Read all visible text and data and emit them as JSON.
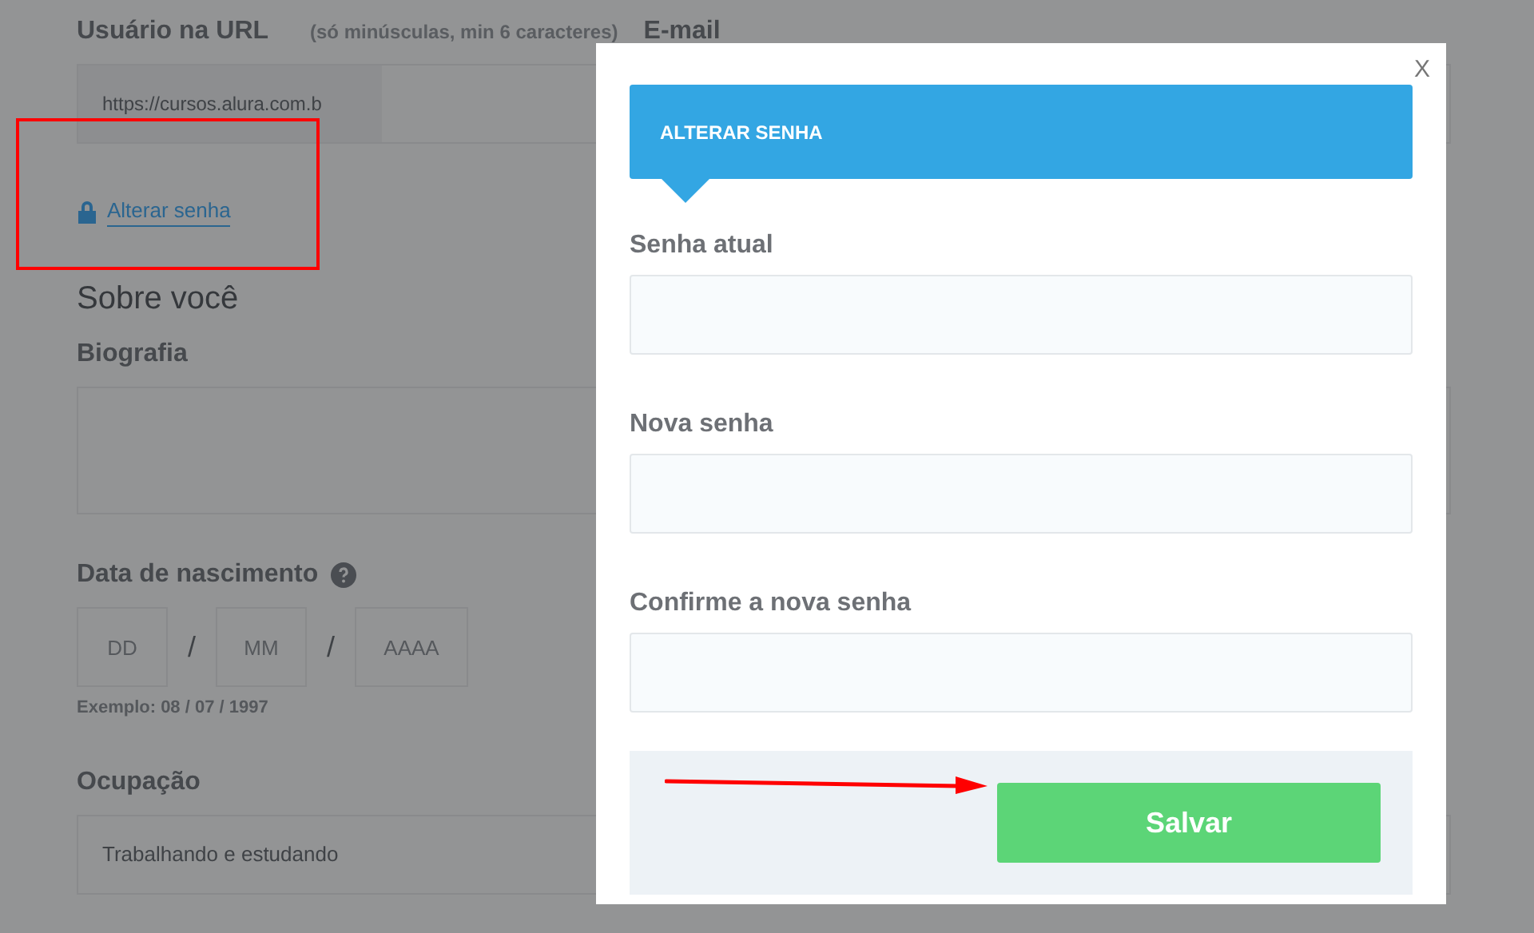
{
  "page": {
    "url_label": "Usuário na URL",
    "url_hint": "(só minúsculas, min 6 caracteres)",
    "email_label": "E-mail",
    "url_value": "https://cursos.alura.com.b",
    "change_password_link": "Alterar senha",
    "about_heading": "Sobre você",
    "bio_label": "Biografia",
    "birth_label": "Data de nascimento",
    "birth_fields": [
      {
        "placeholder": "DD"
      },
      {
        "placeholder": "MM"
      },
      {
        "placeholder": "AAAA"
      }
    ],
    "date_separator": "/",
    "birth_example": "Exemplo: 08 / 07 / 1997",
    "occupation_label": "Ocupação",
    "occupation_value": "Trabalhando e estudando"
  },
  "modal": {
    "close": "X",
    "title": "ALTERAR SENHA",
    "fields": [
      {
        "label": "Senha atual"
      },
      {
        "label": "Nova senha"
      },
      {
        "label": "Confirme a nova senha"
      }
    ],
    "save_button": "Salvar"
  }
}
